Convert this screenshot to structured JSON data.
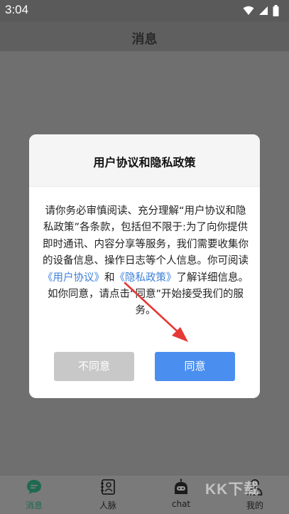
{
  "status_bar": {
    "time": "3:04"
  },
  "header": {
    "title": "消息"
  },
  "dialog": {
    "title": "用户协议和隐私政策",
    "body_part1": "请你务必审慎阅读、充分理解“用户协议和隐私政策”各条款，包括但不限于:为了向你提供即时通讯、内容分享等服务，我们需要收集你的设备信息、操作日志等个人信息。你可阅读",
    "link_user_agreement": "《用户协议》",
    "body_and": "和",
    "link_privacy_policy": "《隐私政策》",
    "body_part2": "了解详细信息。如你同意，请点击“同意”开始接受我们的服务。",
    "disagree_label": "不同意",
    "agree_label": "同意"
  },
  "bottom_nav": {
    "items": [
      {
        "label": "消息",
        "icon": "chat-bubble-icon",
        "active": true
      },
      {
        "label": "人脉",
        "icon": "contacts-icon",
        "active": false
      },
      {
        "label": "chat",
        "icon": "robot-icon",
        "active": false
      },
      {
        "label": "我的",
        "icon": "person-icon",
        "active": false
      }
    ]
  },
  "watermark": {
    "text": "KK下载"
  },
  "colors": {
    "accent": "#4a8ef0",
    "link": "#3b7fd9",
    "active_tab": "#1d6a50"
  }
}
